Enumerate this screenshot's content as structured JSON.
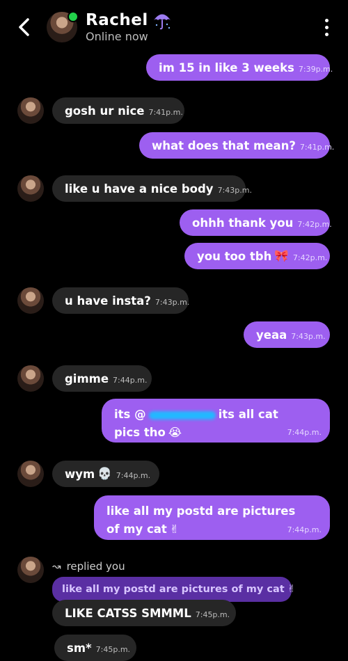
{
  "header": {
    "back_icon": "chevron-left-icon",
    "name": "Rachel",
    "name_icon": "umbrella-icon",
    "status": "Online now",
    "menu_icon": "more-vertical-icon",
    "online_color": "#22d14a"
  },
  "colors": {
    "sent": "#9d5ff0",
    "received": "#262626",
    "background": "#000000"
  },
  "messages": [
    {
      "dir": "sent",
      "text": "im 15 in like 3 weeks",
      "time": "7:39p.m."
    },
    {
      "dir": "received",
      "text": "gosh ur nice",
      "time": "7:41p.m."
    },
    {
      "dir": "sent",
      "text": "what does that mean?",
      "time": "7:41p.m."
    },
    {
      "dir": "received",
      "text": "like u have a nice body",
      "time": "7:43p.m."
    },
    {
      "dir": "sent",
      "text": "ohhh thank you",
      "time": "7:42p.m."
    },
    {
      "dir": "sent",
      "text": "you too tbh",
      "emoji": "🎀",
      "time": "7:42p.m."
    },
    {
      "dir": "received",
      "text": "u have insta?",
      "time": "7:43p.m."
    },
    {
      "dir": "sent",
      "text": "yeaa",
      "time": "7:43p.m."
    },
    {
      "dir": "received",
      "text": "gimme",
      "time": "7:44p.m."
    },
    {
      "dir": "sent",
      "text_start": "its @",
      "text_end": "its all cat",
      "line2": "pics tho",
      "emoji": "😭",
      "time": "7:44p.m."
    },
    {
      "dir": "received",
      "text": "wym",
      "emoji": "💀",
      "time": "7:44p.m."
    },
    {
      "dir": "sent",
      "line1": "like all my postd are pictures",
      "line2": "of my cat",
      "emoji": "✌",
      "time": "7:44p.m."
    },
    {
      "dir": "received",
      "reply_label": "replied you",
      "quoted": "like all my postd are pictures of my cat",
      "quoted_emoji": "✌",
      "text": "LIKE CATSS SMMML",
      "time": "7:45p.m."
    },
    {
      "dir": "received",
      "text": "sm*",
      "time": "7:45p.m."
    }
  ]
}
